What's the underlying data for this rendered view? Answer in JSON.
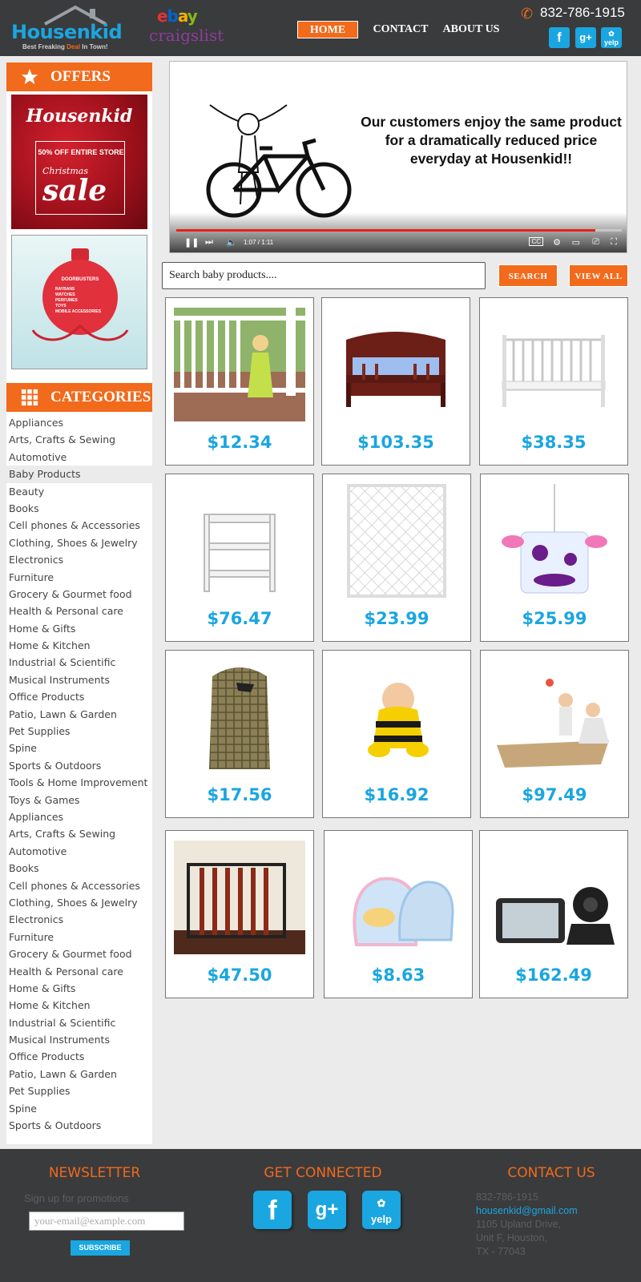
{
  "header": {
    "logo_text": "Housenkid",
    "logo_tag_pre": "Best Freaking ",
    "logo_tag_deal": "Deal",
    "logo_tag_post": " In Town!",
    "partner_ebay": [
      "e",
      "b",
      "a",
      "y"
    ],
    "partner_craigslist": "craigslist",
    "nav": {
      "home": "HOME",
      "contact": "CONTACT",
      "about": "ABOUT US"
    },
    "phone": "832-786-1915",
    "social": {
      "facebook": "f",
      "googleplus": "g+",
      "yelp": "yelp"
    }
  },
  "sidebar": {
    "offers_title": "OFFERS",
    "promo1": {
      "brand": "Housenkid",
      "offer": "50% OFF ENTIRE STORE",
      "line": "Christmas",
      "sale": "sale"
    },
    "promo2": {
      "title": "DOORBUSTERS",
      "items": [
        "RAYBANS",
        "WATCHES",
        "PERFUMES",
        "TOYS",
        "MOBILE ACCESSORIES"
      ]
    },
    "categories_title": "CATEGORIES",
    "categories": [
      "Appliances",
      "Arts, Crafts & Sewing",
      "Automotive",
      "Baby Products",
      "Beauty",
      "Books",
      "Cell phones & Accessories",
      "Clothing, Shoes & Jewelry",
      "Electronics",
      "Furniture",
      "Grocery & Gourmet food",
      "Health & Personal care",
      "Home & Gifts",
      "Home & Kitchen",
      "Industrial & Scientific",
      "Musical Instruments",
      "Office Products",
      "Patio, Lawn & Garden",
      "Pet Supplies",
      "Spine",
      "Sports & Outdoors",
      "Tools & Home Improvement",
      "Toys & Games",
      "Appliances",
      "Arts, Crafts & Sewing",
      "Automotive",
      "Books",
      "Cell phones & Accessories",
      "Clothing, Shoes & Jewelry",
      "Electronics",
      "Furniture",
      "Grocery & Gourmet food",
      "Health & Personal care",
      "Home & Gifts",
      "Home & Kitchen",
      "Industrial & Scientific",
      "Musical Instruments",
      "Office Products",
      "Patio, Lawn & Garden",
      "Pet Supplies",
      "Spine",
      "Sports & Outdoors"
    ],
    "active_category_index": 3
  },
  "video": {
    "caption": "Our customers enjoy the same product for a dramatically reduced price everyday at Housenkid!!",
    "time": "1:07 / 1:11",
    "progress": 0.94
  },
  "search": {
    "placeholder": "Search baby products....",
    "search_label": "SEARCH",
    "view_all_label": "VIEW ALL"
  },
  "products": [
    {
      "name": "baby-on-porch",
      "price": "$12.34"
    },
    {
      "name": "toddler-bed",
      "price": "$103.35"
    },
    {
      "name": "white-crib",
      "price": "$38.35"
    },
    {
      "name": "changing-table",
      "price": "$76.47"
    },
    {
      "name": "mesh-gate",
      "price": "$23.99"
    },
    {
      "name": "cow-mobile",
      "price": "$25.99"
    },
    {
      "name": "diaper-stacker",
      "price": "$17.56"
    },
    {
      "name": "bee-costume",
      "price": "$16.92"
    },
    {
      "name": "play-mat",
      "price": "$97.49"
    },
    {
      "name": "safety-gate",
      "price": "$47.50"
    },
    {
      "name": "baby-bags",
      "price": "$8.63"
    },
    {
      "name": "baby-monitor",
      "price": "$162.49"
    }
  ],
  "footer": {
    "newsletter_title": "NEWSLETTER",
    "newsletter_sub": "Sign up for promotions",
    "email_placeholder": "your-email@example.com",
    "subscribe_label": "SUBSCRIBE",
    "connected_title": "GET CONNECTED",
    "contact_title": "CONTACT US",
    "contact": {
      "phone": "832-786-1915",
      "email": "housenkid@gmail.com",
      "address1": "1105 Upland Drive,",
      "address2": "Unit F, Houston,",
      "address3": "TX - 77043"
    }
  },
  "colors": {
    "accent": "#f26a1b",
    "brand_blue": "#1aa6e0",
    "dark": "#3a3b3d"
  }
}
